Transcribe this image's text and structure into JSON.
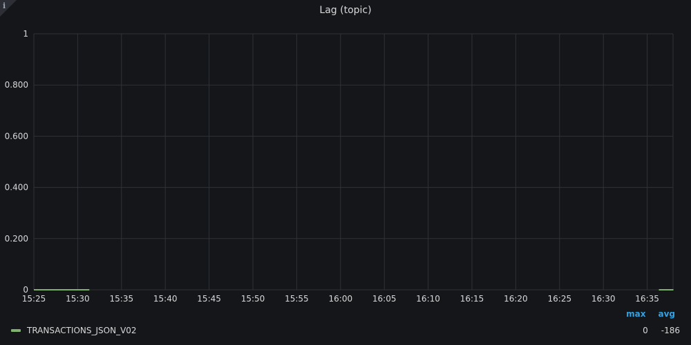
{
  "panel": {
    "title": "Lag (topic)",
    "info_icon": "info-icon",
    "info_glyph": "i"
  },
  "chart_data": {
    "type": "line",
    "title": "Lag (topic)",
    "xlabel": "",
    "ylabel": "",
    "x_ticks": [
      "15:25",
      "15:30",
      "15:35",
      "15:40",
      "15:45",
      "15:50",
      "15:55",
      "16:00",
      "16:05",
      "16:10",
      "16:15",
      "16:20",
      "16:25",
      "16:30",
      "16:35"
    ],
    "x_range": [
      "15:25",
      "16:38"
    ],
    "y_ticks": [
      "0",
      "0.200",
      "0.400",
      "0.600",
      "0.800",
      "1"
    ],
    "y_tick_values": [
      0,
      0.2,
      0.4,
      0.6,
      0.8,
      1
    ],
    "ylim": [
      0,
      1
    ],
    "grid": true,
    "legend_placement": "bottom",
    "series": [
      {
        "name": "TRANSACTIONS_JSON_V02",
        "color": "#7eb26d",
        "segments": [
          {
            "x": [
              "15:25",
              "15:31:20"
            ],
            "y": [
              0,
              0
            ]
          },
          {
            "x": [
              "16:36:20",
              "16:38"
            ],
            "y": [
              0,
              0
            ]
          }
        ]
      }
    ]
  },
  "legend": {
    "headers": {
      "max": "max",
      "avg": "avg"
    },
    "rows": [
      {
        "name": "TRANSACTIONS_JSON_V02",
        "max": "0",
        "avg": "-186",
        "color": "#7eb26d"
      }
    ]
  }
}
